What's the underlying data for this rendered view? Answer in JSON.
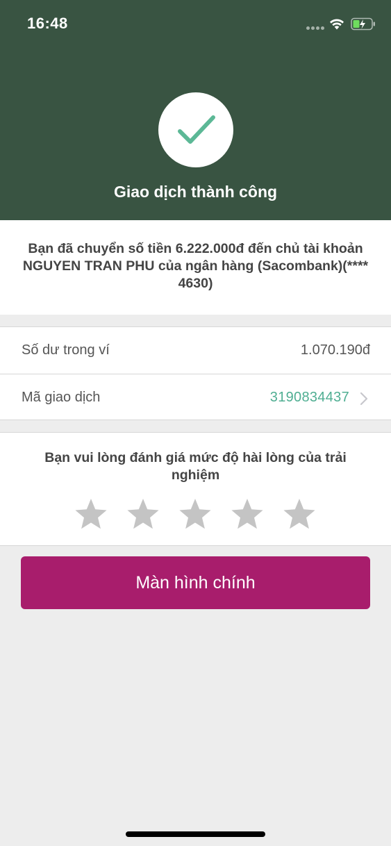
{
  "status_bar": {
    "time": "16:48"
  },
  "header": {
    "title": "Giao dịch thành công",
    "background_color": "#395442",
    "check_color": "#5cb896"
  },
  "message": {
    "text": "Bạn đã chuyển số tiền 6.222.000đ đến chủ tài khoản NGUYEN TRAN PHU của ngân hàng (Sacombank)(**** 4630)"
  },
  "info": {
    "balance_label": "Số dư trong ví",
    "balance_value": "1.070.190đ",
    "transaction_label": "Mã giao dịch",
    "transaction_value": "3190834437",
    "link_color": "#4fae92"
  },
  "rating": {
    "prompt": "Bạn vui lòng đánh giá mức độ hài lòng của trải nghiệm",
    "stars_total": 5,
    "stars_selected": 0,
    "star_color": "#c4c4c4"
  },
  "actions": {
    "main_button_label": "Màn hình chính",
    "button_color": "#a81d6c"
  }
}
